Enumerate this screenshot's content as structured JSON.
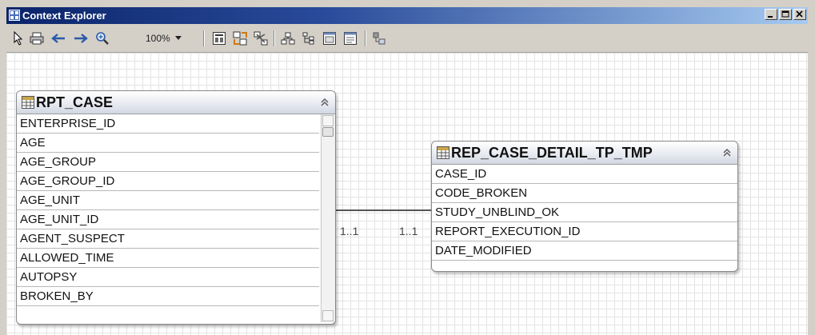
{
  "window": {
    "title": "Context Explorer"
  },
  "toolbar": {
    "zoom": "100%"
  },
  "entities": [
    {
      "name": "RPT_CASE",
      "fields": [
        "ENTERPRISE_ID",
        "AGE",
        "AGE_GROUP",
        "AGE_GROUP_ID",
        "AGE_UNIT",
        "AGE_UNIT_ID",
        "AGENT_SUSPECT",
        "ALLOWED_TIME",
        "AUTOPSY",
        "BROKEN_BY"
      ]
    },
    {
      "name": "REP_CASE_DETAIL_TP_TMP",
      "fields": [
        "CASE_ID",
        "CODE_BROKEN",
        "STUDY_UNBLIND_OK",
        "REPORT_EXECUTION_ID",
        "DATE_MODIFIED"
      ]
    }
  ],
  "relationship": {
    "left_cardinality": "1..1",
    "right_cardinality": "1..1"
  },
  "icons": [
    "pointer-icon",
    "print-icon",
    "back-arrow-icon",
    "forward-arrow-icon",
    "zoom-icon",
    "chevron-down-icon",
    "grid-layout-icon",
    "auto-arrange-icon",
    "remove-icon",
    "hierarchy-icon",
    "tree-icon",
    "expand-view-icon",
    "collapse-view-icon",
    "overview-icon",
    "table-icon",
    "collapse-icon"
  ]
}
